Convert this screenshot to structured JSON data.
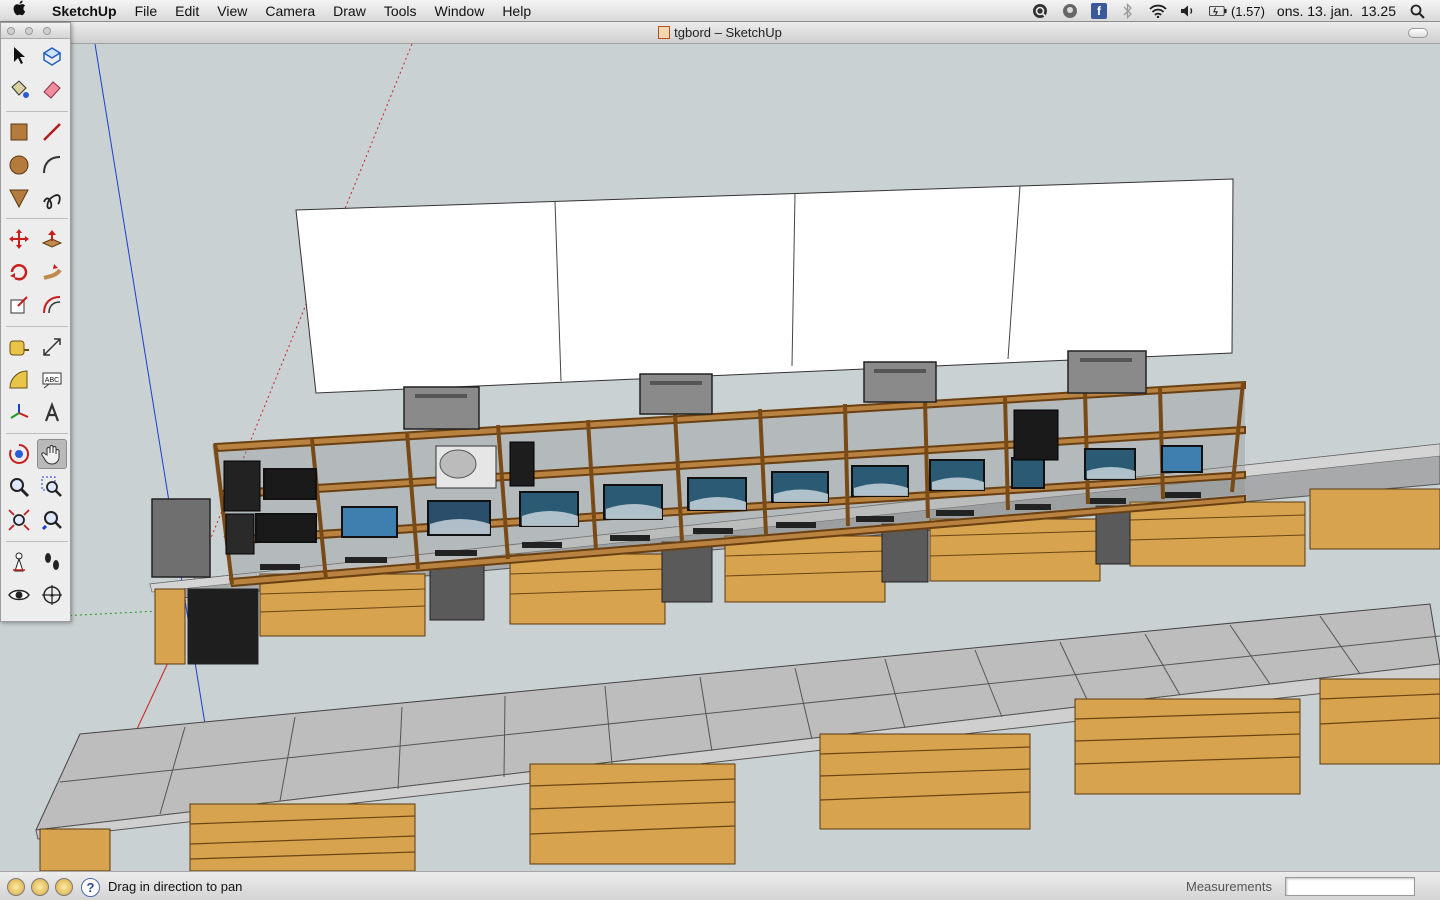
{
  "menubar": {
    "apple": "",
    "items": [
      "SketchUp",
      "File",
      "Edit",
      "View",
      "Camera",
      "Draw",
      "Tools",
      "Window",
      "Help"
    ],
    "battery": "(1.57)",
    "clock": "ons. 13. jan.  13.25",
    "facebook_icon_text": "f"
  },
  "window": {
    "title": "tgbord – SketchUp"
  },
  "toolbar": {
    "tools": [
      "select-icon",
      "make-component-icon",
      "paint-bucket-icon",
      "eraser-icon",
      "rectangle-icon",
      "line-icon",
      "circle-icon",
      "arc-icon",
      "polygon-icon",
      "freehand-icon",
      "move-icon",
      "push-pull-icon",
      "rotate-icon",
      "follow-me-icon",
      "scale-icon",
      "offset-icon",
      "tape-measure-icon",
      "dimension-icon",
      "protractor-icon",
      "text-icon",
      "axes-icon",
      "3d-text-icon",
      "orbit-icon",
      "pan-icon",
      "zoom-icon",
      "zoom-window-icon",
      "zoom-extents-icon",
      "previous-view-icon",
      "position-camera-icon",
      "walk-icon",
      "look-around-icon",
      "section-plane-icon"
    ],
    "text_tool_label": "ABC",
    "active_tool": "pan-icon"
  },
  "statusbar": {
    "help_glyph": "?",
    "message": "Drag in direction to pan",
    "measurements_label": "Measurements",
    "measurements_value": ""
  },
  "colors": {
    "sky": "#c9d1d3",
    "ground": "#c9d1d3",
    "shelf_wood": "#a9733a",
    "pallet_wood": "#d7a34e",
    "table_top": "#bdbdbd",
    "screen_white": "#ffffff",
    "axis_blue": "#1a3fd0",
    "axis_red": "#d02020",
    "axis_green": "#1e9a1e"
  }
}
